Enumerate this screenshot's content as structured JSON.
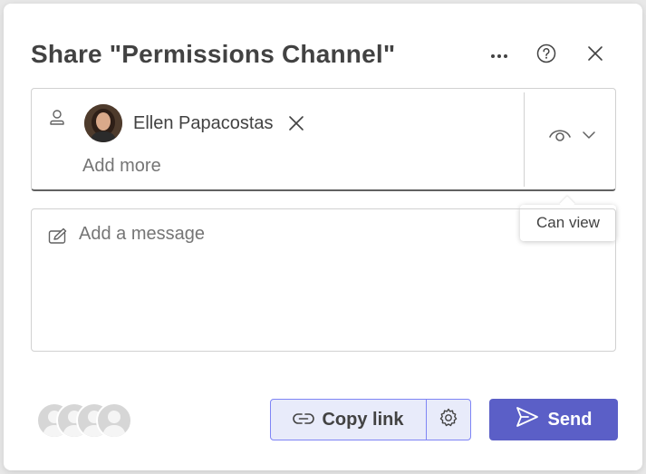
{
  "dialog": {
    "title": "Share \"Permissions Channel\""
  },
  "header": {
    "icons": [
      "more-options-icon",
      "help-icon",
      "close-icon"
    ]
  },
  "recipients": {
    "items": [
      {
        "name": "Ellen Papacostas"
      }
    ],
    "add_more_placeholder": "Add more"
  },
  "permission": {
    "icon": "eye-icon",
    "tooltip": "Can view"
  },
  "message": {
    "placeholder": "Add a message"
  },
  "footer": {
    "copy_link_label": "Copy link",
    "send_label": "Send"
  },
  "colors": {
    "accent": "#5b5fc7",
    "copy_bg": "#e8ebfa",
    "copy_border": "#7f85f5"
  }
}
